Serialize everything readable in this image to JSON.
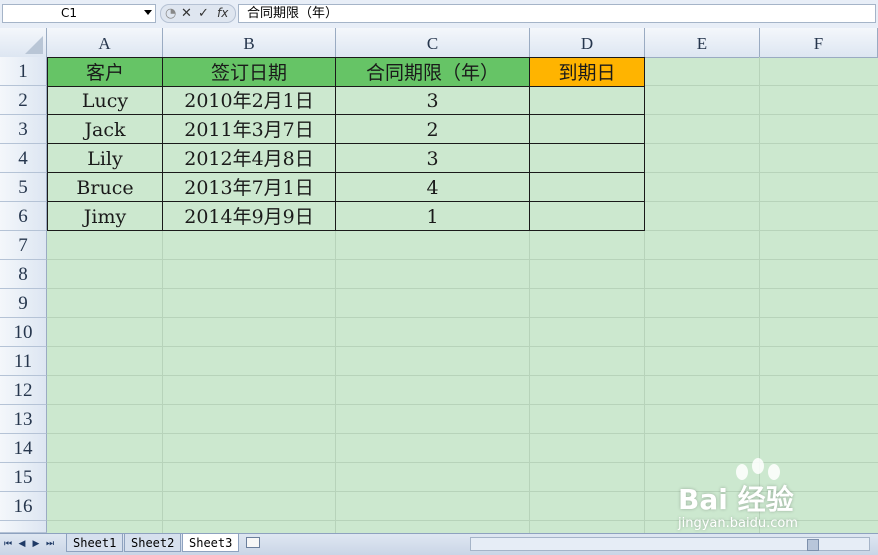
{
  "formula_bar": {
    "name_box": "C1",
    "cancel_glyph": "✕",
    "enter_glyph": "✓",
    "fx_label": "fx",
    "content": "合同期限（年）"
  },
  "columns": [
    "A",
    "B",
    "C",
    "D",
    "E",
    "F"
  ],
  "rows": [
    "1",
    "2",
    "3",
    "4",
    "5",
    "6",
    "7",
    "8",
    "9",
    "10",
    "11",
    "12",
    "13",
    "14",
    "15",
    "16"
  ],
  "table": {
    "headers": [
      "客户",
      "签订日期",
      "合同期限（年）",
      "到期日"
    ],
    "body": [
      [
        "Lucy",
        "2010年2月1日",
        "3",
        ""
      ],
      [
        "Jack",
        "2011年3月7日",
        "2",
        ""
      ],
      [
        "Lily",
        "2012年4月8日",
        "3",
        ""
      ],
      [
        "Bruce",
        "2013年7月1日",
        "4",
        ""
      ],
      [
        "Jimy",
        "2014年9月9日",
        "1",
        ""
      ]
    ]
  },
  "sheet_tabs": [
    "Sheet1",
    "Sheet2",
    "Sheet3"
  ],
  "active_sheet": "Sheet3",
  "watermark": {
    "logo": "Bai 经验",
    "sub": "jingyan.baidu.com"
  },
  "colors": {
    "grid_background": "#cce8cf",
    "header_green": "#66c466",
    "header_orange": "#ffb400"
  }
}
